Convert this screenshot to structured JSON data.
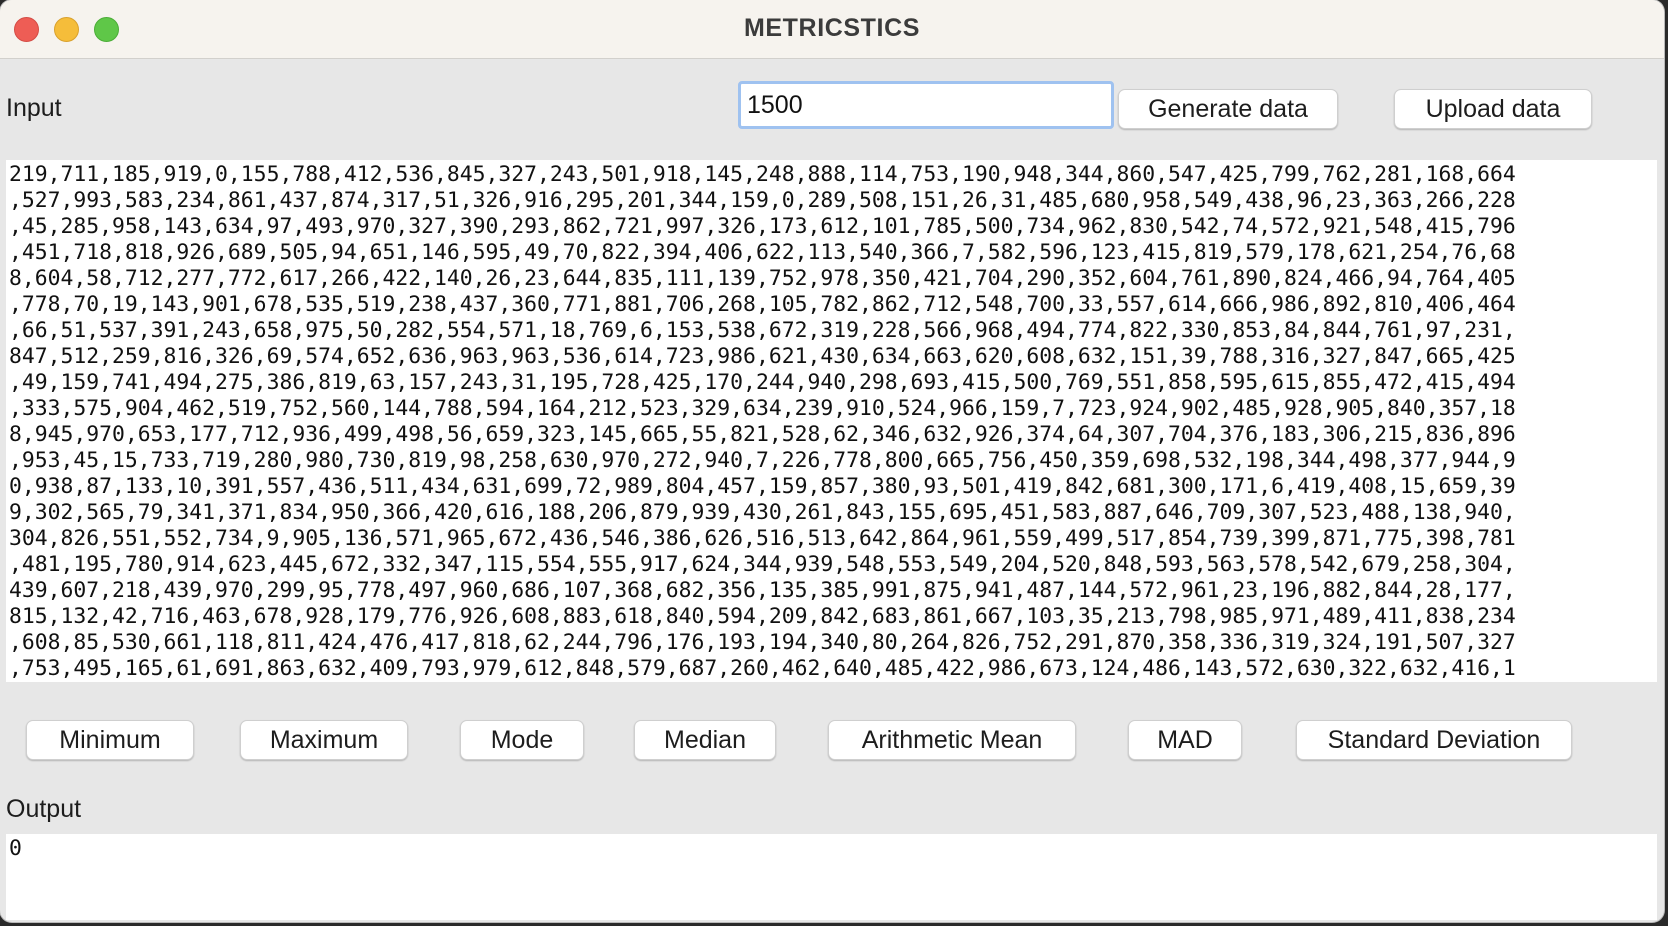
{
  "window": {
    "title": "METRICSTICS"
  },
  "input_row": {
    "label": "Input",
    "count_value": "1500",
    "generate_label": "Generate data",
    "upload_label": "Upload data"
  },
  "data_lines": [
    "219,711,185,919,0,155,788,412,536,845,327,243,501,918,145,248,888,114,753,190,948,344,860,547,425,799,762,281,168,664",
    ",527,993,583,234,861,437,874,317,51,326,916,295,201,344,159,0,289,508,151,26,31,485,680,958,549,438,96,23,363,266,228",
    ",45,285,958,143,634,97,493,970,327,390,293,862,721,997,326,173,612,101,785,500,734,962,830,542,74,572,921,548,415,796",
    ",451,718,818,926,689,505,94,651,146,595,49,70,822,394,406,622,113,540,366,7,582,596,123,415,819,579,178,621,254,76,68",
    "8,604,58,712,277,772,617,266,422,140,26,23,644,835,111,139,752,978,350,421,704,290,352,604,761,890,824,466,94,764,405",
    ",778,70,19,143,901,678,535,519,238,437,360,771,881,706,268,105,782,862,712,548,700,33,557,614,666,986,892,810,406,464",
    ",66,51,537,391,243,658,975,50,282,554,571,18,769,6,153,538,672,319,228,566,968,494,774,822,330,853,84,844,761,97,231,",
    "847,512,259,816,326,69,574,652,636,963,963,536,614,723,986,621,430,634,663,620,608,632,151,39,788,316,327,847,665,425",
    ",49,159,741,494,275,386,819,63,157,243,31,195,728,425,170,244,940,298,693,415,500,769,551,858,595,615,855,472,415,494",
    ",333,575,904,462,519,752,560,144,788,594,164,212,523,329,634,239,910,524,966,159,7,723,924,902,485,928,905,840,357,18",
    "8,945,970,653,177,712,936,499,498,56,659,323,145,665,55,821,528,62,346,632,926,374,64,307,704,376,183,306,215,836,896",
    ",953,45,15,733,719,280,980,730,819,98,258,630,970,272,940,7,226,778,800,665,756,450,359,698,532,198,344,498,377,944,9",
    "0,938,87,133,10,391,557,436,511,434,631,699,72,989,804,457,159,857,380,93,501,419,842,681,300,171,6,419,408,15,659,39",
    "9,302,565,79,341,371,834,950,366,420,616,188,206,879,939,430,261,843,155,695,451,583,887,646,709,307,523,488,138,940,",
    "304,826,551,552,734,9,905,136,571,965,672,436,546,386,626,516,513,642,864,961,559,499,517,854,739,399,871,775,398,781",
    ",481,195,780,914,623,445,672,332,347,115,554,555,917,624,344,939,548,553,549,204,520,848,593,563,578,542,679,258,304,",
    "439,607,218,439,970,299,95,778,497,960,686,107,368,682,356,135,385,991,875,941,487,144,572,961,23,196,882,844,28,177,",
    "815,132,42,716,463,678,928,179,776,926,608,883,618,840,594,209,842,683,861,667,103,35,213,798,985,971,489,411,838,234",
    ",608,85,530,661,118,811,424,476,417,818,62,244,796,176,193,194,340,80,264,826,752,291,870,358,336,319,324,191,507,327",
    ",753,495,165,61,691,863,632,409,793,979,612,848,579,687,260,462,640,485,422,986,673,124,486,143,572,630,322,632,416,1"
  ],
  "stats_buttons": [
    "Minimum",
    "Maximum",
    "Mode",
    "Median",
    "Arithmetic Mean",
    "MAD",
    "Standard Deviation"
  ],
  "output": {
    "label": "Output",
    "value": "0"
  }
}
